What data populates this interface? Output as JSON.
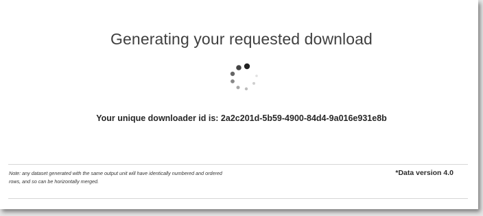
{
  "page": {
    "title": "Generating your requested download",
    "downloader_id_line": "Your unique downloader id is: 2a2c201d-5b59-4900-84d4-9a016e931e8b",
    "note": "Note: any dataset generated with the same output unit will have identically numbered and ordered rows, and so can be horizontally merged.",
    "data_version": "*Data version 4.0"
  },
  "icons": {
    "spinner": "loading-spinner-icon"
  }
}
